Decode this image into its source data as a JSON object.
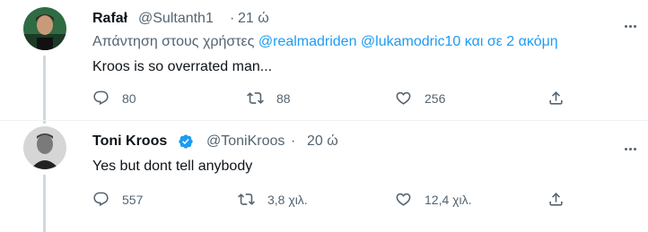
{
  "tweet1": {
    "display_name": "Rafał",
    "handle": "@Sultanth1",
    "separator": "·",
    "time": "21 ώ",
    "reply_prefix": "Απάντηση στους χρήστες",
    "mention1": "@realmadriden",
    "mention2": "@lukamodric10",
    "reply_suffix": "και σε 2 ακόμη",
    "text": "Kroos is so overrated man...",
    "replies": "80",
    "retweets": "88",
    "likes": "256"
  },
  "tweet2": {
    "display_name": "Toni Kroos",
    "handle": "@ToniKroos",
    "separator": "·",
    "time": "20 ώ",
    "text": "Yes but dont tell anybody",
    "replies": "557",
    "retweets": "3,8 χιλ.",
    "likes": "12,4 χιλ."
  },
  "colors": {
    "link": "#1d9bf0",
    "muted": "#536471",
    "verified": "#1d9bf0"
  },
  "icons": [
    "reply-icon",
    "retweet-icon",
    "like-icon",
    "share-icon",
    "verified-badge-icon",
    "more-icon"
  ]
}
